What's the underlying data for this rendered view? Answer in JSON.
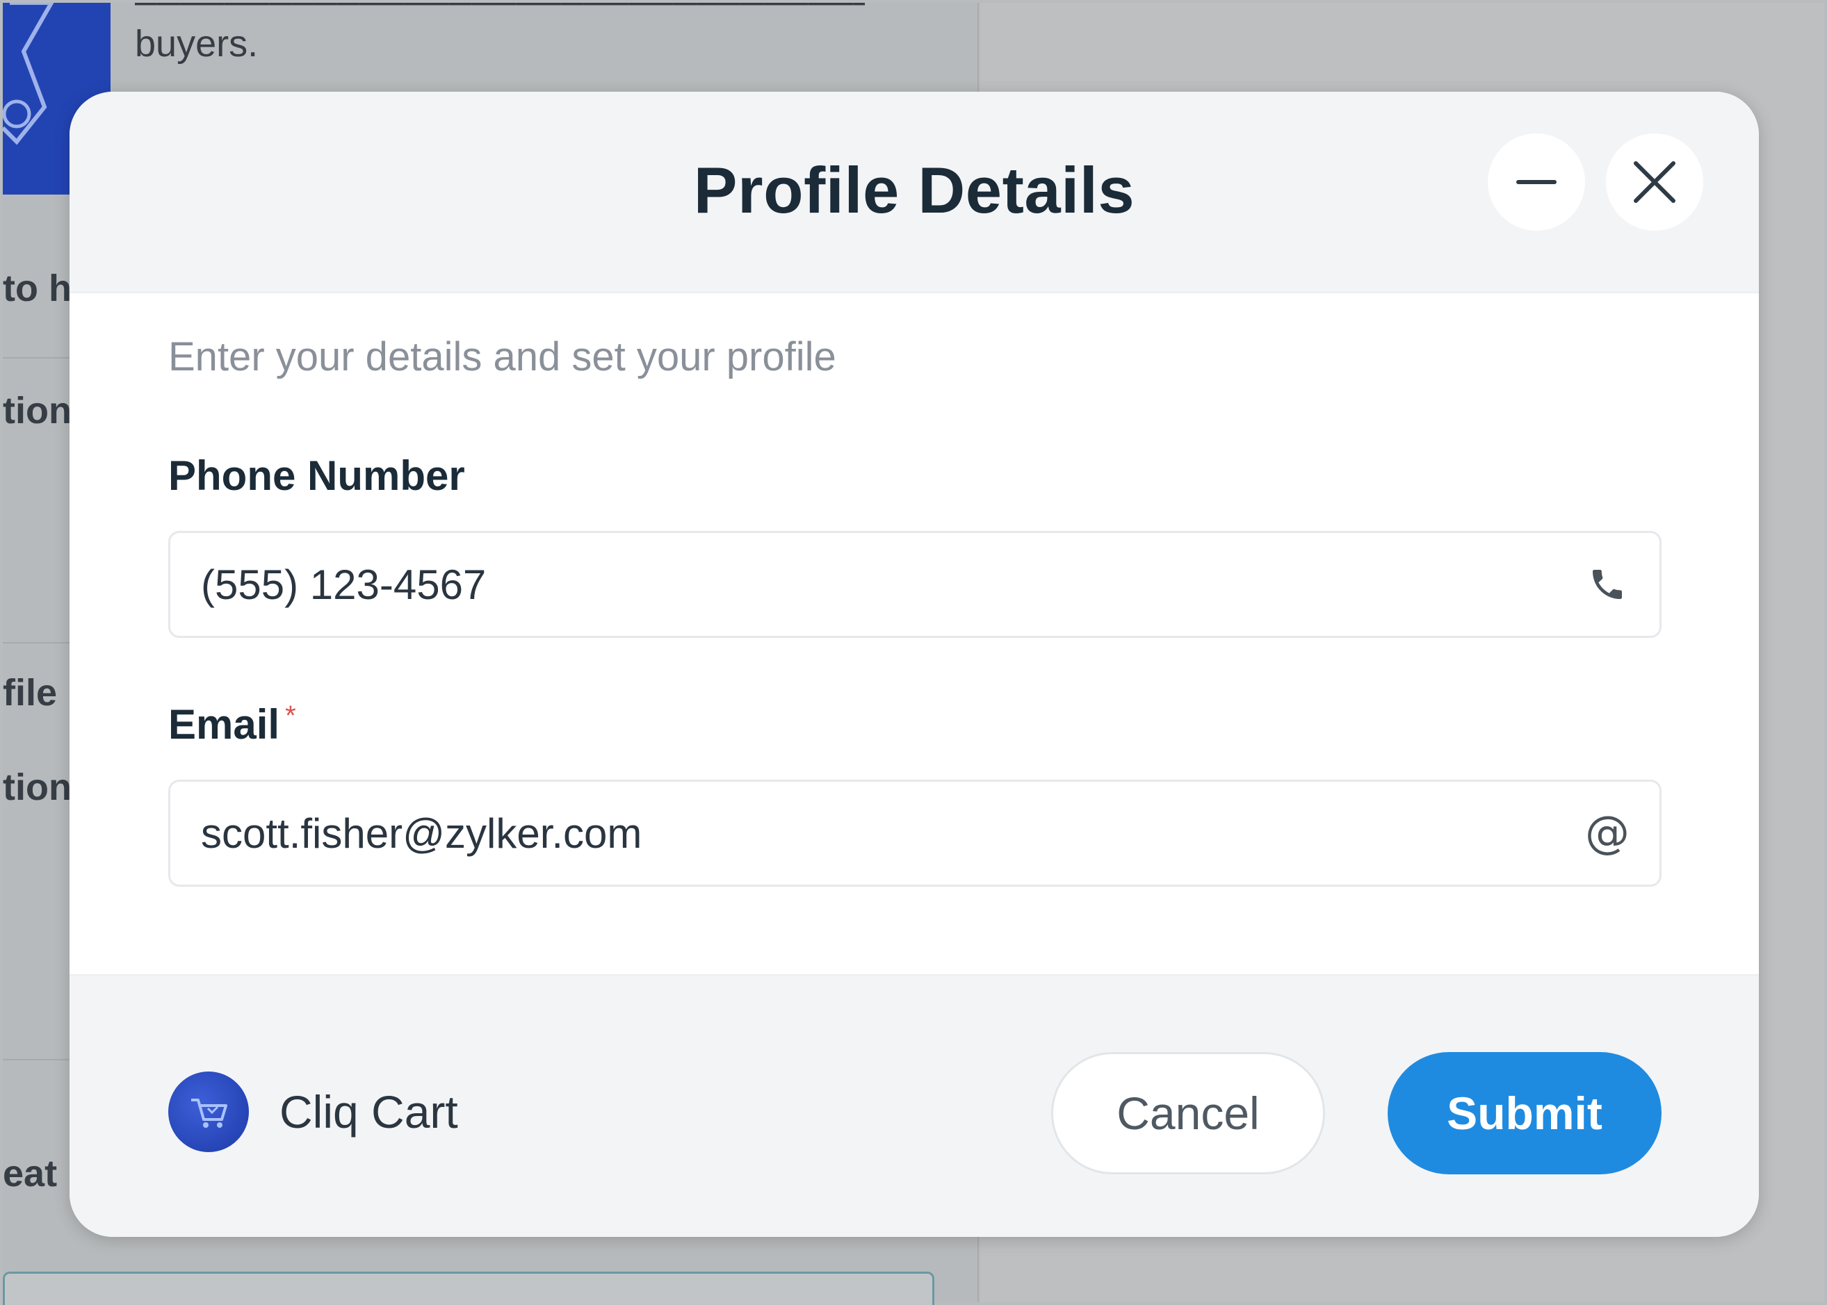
{
  "background": {
    "visible_text_line": "buyers.",
    "fragments": [
      "to h",
      "tions",
      "file",
      "tion",
      "eat"
    ]
  },
  "modal": {
    "title": "Profile Details",
    "subtitle": "Enter your details and set your profile",
    "icons": {
      "minimize": "minimize-icon",
      "close": "close-icon"
    },
    "fields": {
      "phone": {
        "label": "Phone Number",
        "value": "(555) 123-4567",
        "icon": "phone-icon"
      },
      "email": {
        "label": "Email",
        "required_mark": "*",
        "value": "scott.fisher@zylker.com",
        "icon_text": "@"
      }
    },
    "footer": {
      "brand_name": "Cliq Cart",
      "cancel_label": "Cancel",
      "submit_label": "Submit"
    }
  },
  "colors": {
    "primary": "#1f8be0",
    "required": "#d9534f",
    "title": "#1b2b38"
  }
}
